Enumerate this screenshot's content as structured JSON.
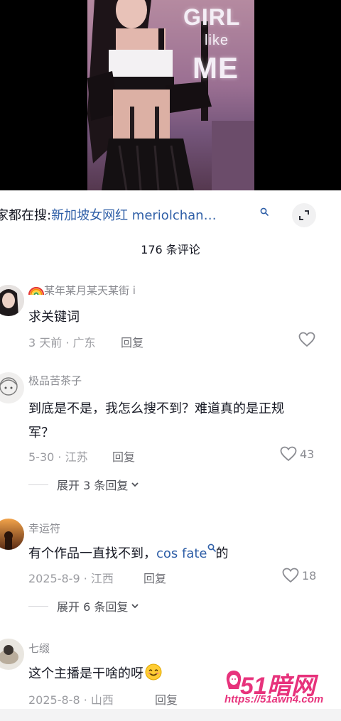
{
  "video": {
    "overlay_line1": "GIRL",
    "overlay_line2": "like",
    "overlay_line3": "ME"
  },
  "search_bar": {
    "prefix": "家都在搜:",
    "query": "新加坡女网红 meriolchan…",
    "search_icon": "search-icon",
    "expand_icon": "expand-icon"
  },
  "comment_count": "176 条评论",
  "comments": [
    {
      "username": "某年某月某天某街 i",
      "username_prefix_icon": "rainbow-emoji",
      "text": "求关键词",
      "meta": "3 天前 · 广东",
      "reply_label": "回复",
      "likes": ""
    },
    {
      "username": "极品苦茶子",
      "text_line1": "到底是不是，我怎么搜不到？难道真的是正规",
      "text_line2": "军？",
      "meta": "5-30 · 江苏",
      "reply_label": "回复",
      "likes": "43",
      "expand_label": "展开 3 条回复"
    },
    {
      "username": "幸运符",
      "text_prefix": "有个作品一直找不到，",
      "text_link": "cos fate",
      "text_suffix": "的",
      "meta": "2025-8-9 · 江西",
      "reply_label": "回复",
      "likes": "18",
      "expand_label": "展开 6 条回复"
    },
    {
      "username": "七缀",
      "text": "这个主播是干啥的呀",
      "text_emoji": "smile-emoji",
      "meta": "2025-8-8 · 山西",
      "reply_label": "回复"
    }
  ],
  "watermark": {
    "logo": "51暗网",
    "url": "https://51awn4.com"
  },
  "colors": {
    "link": "#2f5fa7",
    "secondary_text": "#8a8b91",
    "watermark": "#e7337c"
  }
}
